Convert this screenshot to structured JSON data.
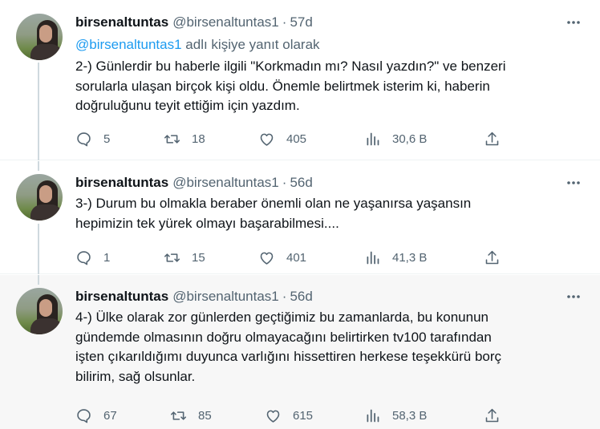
{
  "author": {
    "name": "birsenaltuntas",
    "handle": "@birsenaltuntas1"
  },
  "separator": "·",
  "tweets": [
    {
      "time": "57d",
      "reply_to": {
        "mention": "@birsenaltuntas1",
        "suffix": "adlı kişiye yanıt olarak"
      },
      "text_lines": [
        "2-) Günlerdir bu haberle ilgili \"Korkmadın mı? Nasıl yazdın?\" ve benzeri",
        "sorularla ulaşan birçok kişi oldu. Önemle belirtmek isterim ki, haberin",
        "doğruluğunu teyit ettiğim için yazdım."
      ],
      "stats": {
        "replies": "5",
        "retweets": "18",
        "likes": "405",
        "views": "30,6 B"
      }
    },
    {
      "time": "56d",
      "text_lines": [
        "3-) Durum bu olmakla beraber önemli olan ne yaşanırsa yaşansın",
        "hepimizin tek yürek olmayı başarabilmesi...."
      ],
      "stats": {
        "replies": "1",
        "retweets": "15",
        "likes": "401",
        "views": "41,3 B"
      }
    },
    {
      "time": "56d",
      "text_lines": [
        "4-) Ülke olarak zor günlerden geçtiğimiz bu zamanlarda, bu konunun",
        "gündemde olmasının doğru olmayacağını belirtirken tv100 tarafından",
        "işten çıkarıldığımı duyunca varlığını hissettiren herkese teşekkürü borç",
        "bilirim, sağ olsunlar."
      ],
      "stats": {
        "replies": "67",
        "retweets": "85",
        "likes": "615",
        "views": "58,3 B"
      }
    }
  ],
  "icons": {
    "reply": "speech-bubble-icon",
    "retweet": "retweet-arrows-icon",
    "like": "heart-icon",
    "views": "bar-chart-icon",
    "share": "upload-arrow-icon",
    "more": "three-dots-icon"
  },
  "colors": {
    "text": "#0f1419",
    "secondary": "#536471",
    "link": "#1d9bf0",
    "highlight_bg": "#f7f7f7",
    "thread_line": "#cfd9de"
  }
}
